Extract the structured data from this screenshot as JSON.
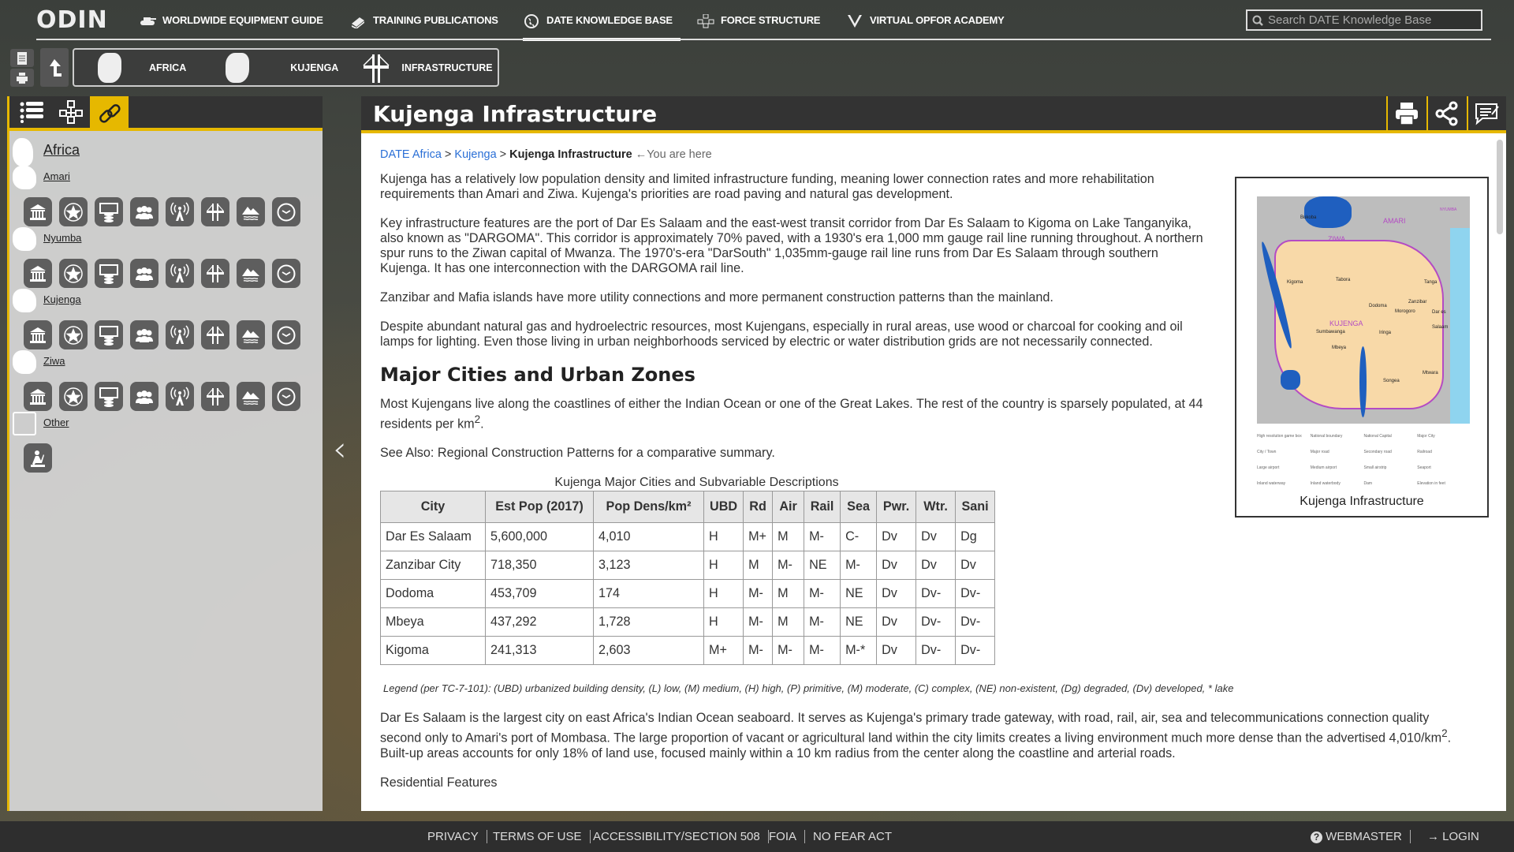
{
  "brand": {
    "logo_text": "ODIN"
  },
  "nav": [
    {
      "label": "WORLDWIDE EQUIPMENT GUIDE",
      "icon": "tank-icon"
    },
    {
      "label": "TRAINING PUBLICATIONS",
      "icon": "books-icon"
    },
    {
      "label": "DATE KNOWLEDGE BASE",
      "icon": "globe-icon",
      "active": true
    },
    {
      "label": "FORCE STRUCTURE",
      "icon": "org-chart-icon"
    },
    {
      "label": "VIRTUAL OPFOR ACADEMY",
      "icon": "academy-icon"
    }
  ],
  "search": {
    "placeholder": "Search DATE Knowledge Base"
  },
  "crumbs": [
    {
      "label": "AFRICA"
    },
    {
      "label": "KUJENGA"
    },
    {
      "label": "INFRASTRUCTURE"
    }
  ],
  "sidebar": {
    "tabs": [
      "list-icon",
      "hierarchy-icon",
      "link-icon"
    ],
    "active_tab": "link-icon",
    "accent": "#e6b800",
    "root": "Africa",
    "regions": [
      {
        "name": "Amari",
        "icons": [
          "government",
          "military",
          "economic",
          "social",
          "information",
          "infrastructure",
          "physical-environment",
          "time"
        ]
      },
      {
        "name": "Nyumba",
        "icons": [
          "government",
          "military",
          "economic",
          "social",
          "information",
          "infrastructure",
          "physical-environment",
          "time"
        ]
      },
      {
        "name": "Kujenga",
        "icons": [
          "government",
          "military",
          "economic",
          "social",
          "information",
          "infrastructure",
          "physical-environment",
          "time"
        ]
      },
      {
        "name": "Ziwa",
        "icons": [
          "government",
          "military",
          "economic",
          "social",
          "information",
          "infrastructure",
          "physical-environment",
          "time"
        ]
      },
      {
        "name": "Other",
        "icons": [
          "soldier"
        ]
      }
    ]
  },
  "main": {
    "title": "Kujenga Infrastructure",
    "breadcrumb": {
      "items": [
        "DATE Africa",
        "Kujenga"
      ],
      "current": "Kujenga Infrastructure",
      "here": "←You are here"
    },
    "paragraphs": [
      "Kujenga has a relatively low population density and limited infrastructure funding, meaning lower connection rates and more rehabilitation requirements than Amari and Ziwa. Kujenga's priorities are road paving and natural gas development.",
      "Key infrastructure features are the port of Dar Es Salaam and the east-west transit corridor from Dar Es Salaam to Kigoma on Lake Tanganyika, also known as \"DARGOMA\". This corridor is approximately 70% paved, with a 1930's era 1,000 mm gauge rail line running throughout. A northern spur runs to the Ziwan capital of Mwanza. The 1970's-era \"DarSouth\" 1,035mm-gauge rail line runs from Dar Es Salaam through southern Kujenga. It has one interconnection with the DARGOMA rail line.",
      "Zanzibar and Mafia islands have more utility connections and more permanent construction patterns than the mainland.",
      "Despite abundant natural gas and hydroelectric resources, most Kujengans, especially in rural areas, use wood or charcoal for cooking and oil lamps for lighting. Even those living in urban neighborhoods serviced by electric or water distribution grids are not necessarily connected."
    ],
    "heading": "Major Cities and Urban Zones",
    "p5": {
      "a": "Most Kujengans live along the coastlines of either the Indian Ocean or one of the Great Lakes. The rest of the country is sparsely populated, at 44 residents per km",
      "sup": "2",
      "b": "."
    },
    "p6": "See Also: Regional Construction Patterns for a comparative summary.",
    "table": {
      "caption": "Kujenga Major Cities and Subvariable Descriptions",
      "headers": [
        "City",
        "Est Pop (2017)",
        "Pop Dens/km²",
        "UBD",
        "Rd",
        "Air",
        "Rail",
        "Sea",
        "Pwr.",
        "Wtr.",
        "Sani"
      ],
      "rows": [
        [
          "Dar Es Salaam",
          "5,600,000",
          "4,010",
          "H",
          "M+",
          "M",
          "M-",
          "C-",
          "Dv",
          "Dv",
          "Dg"
        ],
        [
          "Zanzibar City",
          "718,350",
          "3,123",
          "H",
          "M",
          "M-",
          "NE",
          "M-",
          "Dv",
          "Dv",
          "Dv"
        ],
        [
          "Dodoma",
          "453,709",
          "174",
          "H",
          "M-",
          "M",
          "M-",
          "NE",
          "Dv",
          "Dv-",
          "Dv-"
        ],
        [
          "Mbeya",
          "437,292",
          "1,728",
          "H",
          "M-",
          "M",
          "M-",
          "NE",
          "Dv",
          "Dv-",
          "Dv-"
        ],
        [
          "Kigoma",
          "241,313",
          "2,603",
          "M+",
          "M-",
          "M-",
          "M-",
          "M-*",
          "Dv",
          "Dv-",
          "Dv-"
        ]
      ]
    },
    "legend": "Legend (per TC-7-101): (UBD) urbanized building density, (L) low, (M) medium, (H) high, (P) primitive, (M) moderate, (C) complex, (NE) non-existent, (Dg) degraded, (Dv) developed,  * lake",
    "p7": {
      "a": "Dar Es Salaam is the largest city on east Africa's Indian Ocean seaboard. It serves as Kujenga's primary trade gateway, with road, rail, air, sea and telecommunications connection quality second only to Amari's port of Mombasa. The large proportion of vacant or agricultural land within the city limits creates a living environment much more dense than the advertised 4,010/km",
      "sup": "2",
      "b": ". Built-up areas accounts for only 18% of land use, focused mainly within a 10 km radius from the center along the coastline and arterial roads."
    },
    "next_heading": "Residential Features",
    "figure": {
      "caption": "Kujenga Infrastructure",
      "map_labels": [
        "AMARI",
        "ZIWA",
        "KUJENGA",
        "NYUMBA",
        "Kigoma",
        "Tabora",
        "Dodoma",
        "Mbeya",
        "Dar es Salaam",
        "Tanga",
        "Iringa",
        "Songea",
        "Mtwara",
        "Zanzibar",
        "Morogoro",
        "Sumbawanga",
        "Bukoba"
      ],
      "legend_items": [
        "High resolution game box",
        "National boundary",
        "National Capital",
        "Major City",
        "City / Town",
        "Major road",
        "Secondary road",
        "Railroad",
        "Large airport",
        "Medium airport",
        "Small airstrip",
        "Seaport",
        "Inland waterway",
        "Inland waterbody",
        "Dam",
        "Elevation in feet"
      ]
    },
    "actions": [
      "print-icon",
      "share-icon",
      "feedback-icon"
    ]
  },
  "footer": {
    "links": [
      "PRIVACY",
      "TERMS OF USE",
      "ACCESSIBILITY/SECTION 508",
      "FOIA",
      "NO FEAR ACT"
    ],
    "webmaster": "WEBMASTER",
    "login": "LOGIN"
  }
}
